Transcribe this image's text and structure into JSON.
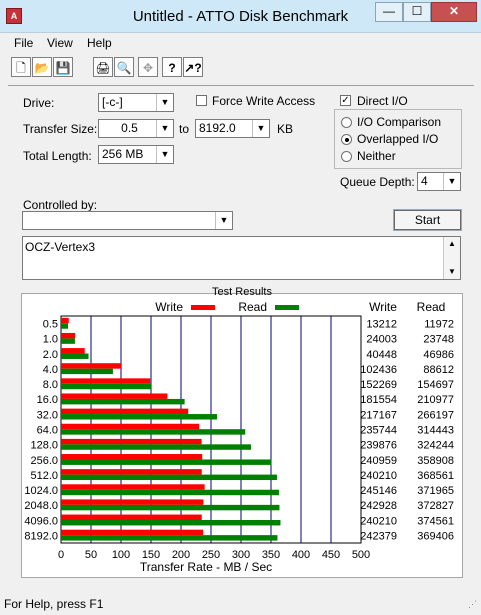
{
  "window": {
    "title": "Untitled - ATTO Disk Benchmark",
    "buttons": {
      "minimize": "—",
      "maximize": "☐",
      "close": "✕"
    }
  },
  "menu": [
    "File",
    "View",
    "Help"
  ],
  "toolbar_icons": [
    "new-file-icon",
    "open-folder-icon",
    "save-icon",
    "print-icon",
    "print-preview-icon",
    "move-icon",
    "help-icon",
    "context-help-icon"
  ],
  "form": {
    "drive_label": "Drive:",
    "drive_value": "[-c-]",
    "force_write_label": "Force Write Access",
    "force_write_checked": false,
    "direct_io_label": "Direct I/O",
    "direct_io_checked": true,
    "transfer_size_label": "Transfer Size:",
    "transfer_from": "0.5",
    "to_label": "to",
    "transfer_to": "8192.0",
    "kb_label": "KB",
    "total_length_label": "Total Length:",
    "total_length_value": "256 MB",
    "io_options": [
      "I/O Comparison",
      "Overlapped I/O",
      "Neither"
    ],
    "io_selected": "Overlapped I/O",
    "queue_depth_label": "Queue Depth:",
    "queue_depth_value": "4",
    "controlled_by_label": "Controlled by:",
    "controlled_by_value": "",
    "start_label": "Start",
    "description": "OCZ-Vertex3"
  },
  "results": {
    "title": "Test Results",
    "write_legend": "Write",
    "read_legend": "Read",
    "write_header": "Write",
    "read_header": "Read"
  },
  "chart_data": {
    "type": "bar",
    "orientation": "horizontal",
    "categories": [
      "0.5",
      "1.0",
      "2.0",
      "4.0",
      "8.0",
      "16.0",
      "32.0",
      "64.0",
      "128.0",
      "256.0",
      "512.0",
      "1024.0",
      "2048.0",
      "4096.0",
      "8192.0"
    ],
    "series": [
      {
        "name": "Write",
        "color": "#ff0000",
        "values": [
          13212,
          24003,
          40448,
          102436,
          152269,
          181554,
          217167,
          235744,
          239876,
          240959,
          240210,
          245146,
          242928,
          240210,
          242379
        ]
      },
      {
        "name": "Read",
        "color": "#008000",
        "values": [
          11972,
          23748,
          46986,
          88612,
          154697,
          210977,
          266197,
          314443,
          324244,
          358908,
          368561,
          371965,
          372827,
          374561,
          369406
        ]
      }
    ],
    "xlabel": "Transfer Rate - MB / Sec",
    "xlim": [
      0,
      500
    ],
    "xticks": [
      "0",
      "50",
      "100",
      "150",
      "200",
      "250",
      "300",
      "350",
      "400",
      "450",
      "500"
    ],
    "grid": true,
    "legend": "top"
  },
  "status": "For Help, press F1"
}
